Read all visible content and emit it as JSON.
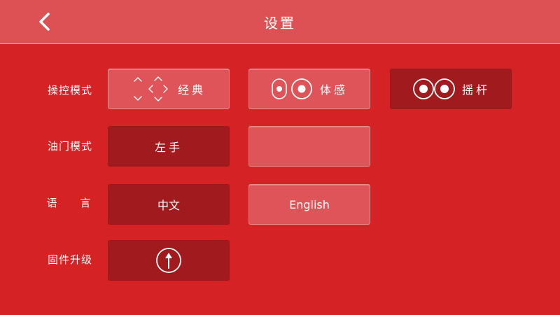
{
  "header": {
    "title": "设置",
    "back_icon": "chevron-left-icon"
  },
  "rows": [
    {
      "label": "操控模式",
      "options": [
        {
          "label": "经典",
          "icon": "dpad-arrows-icon",
          "selected": false
        },
        {
          "label": "体感",
          "icon": "motion-sense-icon",
          "selected": false
        },
        {
          "label": "摇杆",
          "icon": "dual-joystick-icon",
          "selected": true
        }
      ]
    },
    {
      "label": "油门模式",
      "options": [
        {
          "label": "左手",
          "selected": true
        },
        {
          "label": "",
          "selected": false
        }
      ]
    },
    {
      "label": "语 言",
      "options": [
        {
          "label": "中文",
          "selected": true
        },
        {
          "label": "English",
          "selected": false
        }
      ]
    },
    {
      "label": "固件升级",
      "options": [
        {
          "label": "",
          "icon": "upgrade-arrow-icon"
        }
      ]
    }
  ],
  "colors": {
    "background": "#d42225",
    "header": "#dd5155",
    "button_light": "#de5458",
    "button_selected": "#a11b1e"
  }
}
